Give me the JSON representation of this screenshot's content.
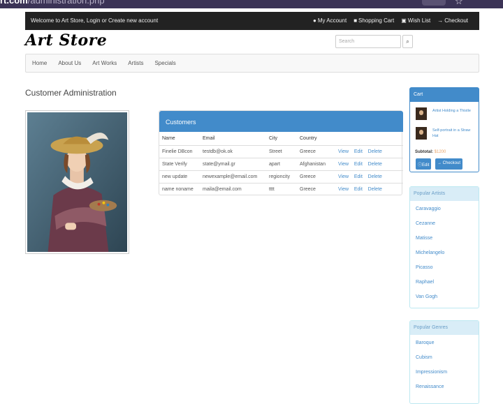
{
  "browser": {
    "url_host": "rt.com",
    "url_path": "/administration.php"
  },
  "topbar": {
    "welcome": "Welcome to Art Store, Login or Create new account",
    "links": [
      {
        "icon": "user-icon",
        "glyph": "👤",
        "label": "My Account"
      },
      {
        "icon": "cart-icon",
        "glyph": "🛒",
        "label": "Shopping Cart"
      },
      {
        "icon": "gift-icon",
        "glyph": "🎁",
        "label": "Wish List"
      },
      {
        "icon": "arrow-right-icon",
        "glyph": "➜",
        "label": "Checkout"
      }
    ]
  },
  "header": {
    "logo": "Art Store",
    "search_placeholder": "Search"
  },
  "nav": [
    "Home",
    "About Us",
    "Art Works",
    "Artists",
    "Specials"
  ],
  "main": {
    "title": "Customer Administration",
    "panel_title": "Customers",
    "columns": [
      "Name",
      "Email",
      "City",
      "Country"
    ],
    "rows": [
      {
        "name": "Finelie DBcon",
        "email": "testdb@ok.ok",
        "city": "Street",
        "country": "Greece"
      },
      {
        "name": "State Verify",
        "email": "state@ymail.gr",
        "city": "apart",
        "country": "Afghanistan"
      },
      {
        "name": "new update",
        "email": "newexample@email.com",
        "city": "regioncity",
        "country": "Greece"
      },
      {
        "name": "name noname",
        "email": "maila@email.com",
        "city": "tttt",
        "country": "Greece"
      }
    ],
    "actions": {
      "view": "View",
      "edit": "Edit",
      "delete": "Delete"
    }
  },
  "cart": {
    "title": "Cart",
    "items": [
      "Artist Holding a Thistle",
      "Self-portrait in a Straw Hat"
    ],
    "subtotal_label": "Subtotal:",
    "subtotal_value": "$1200",
    "edit_label": "Edit",
    "checkout_label": "Checkout"
  },
  "popular_artists": {
    "title": "Popular Artists",
    "items": [
      "Caravaggio",
      "Cezanne",
      "Matisse",
      "Michelangelo",
      "Picasso",
      "Raphael",
      "Van Gogh"
    ]
  },
  "popular_genres": {
    "title": "Popular Genres",
    "items": [
      "Baroque",
      "Cubism",
      "Impressionism",
      "Renaissance"
    ]
  },
  "colors": {
    "primary": "#428bca",
    "topbar": "#222222",
    "price": "#e8a56b"
  }
}
